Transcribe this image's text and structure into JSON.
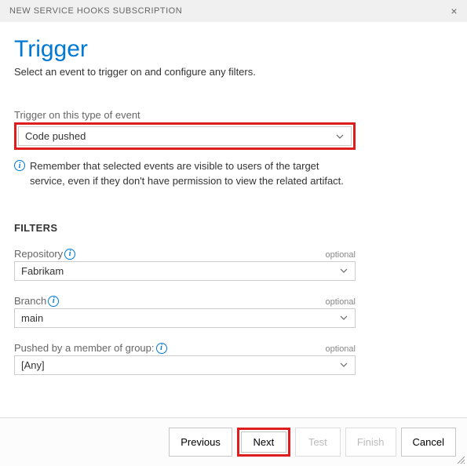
{
  "header": {
    "title": "NEW SERVICE HOOKS SUBSCRIPTION"
  },
  "page": {
    "title": "Trigger",
    "subtitle": "Select an event to trigger on and configure any filters."
  },
  "event": {
    "label": "Trigger on this type of event",
    "value": "Code pushed",
    "note": "Remember that selected events are visible to users of the target service, even if they don't have permission to view the related artifact."
  },
  "filters": {
    "title": "FILTERS",
    "repository": {
      "label": "Repository",
      "optional": "optional",
      "value": "Fabrikam"
    },
    "branch": {
      "label": "Branch",
      "optional": "optional",
      "value": "main"
    },
    "group": {
      "label": "Pushed by a member of group:",
      "optional": "optional",
      "value": "[Any]"
    }
  },
  "buttons": {
    "previous": "Previous",
    "next": "Next",
    "test": "Test",
    "finish": "Finish",
    "cancel": "Cancel"
  }
}
